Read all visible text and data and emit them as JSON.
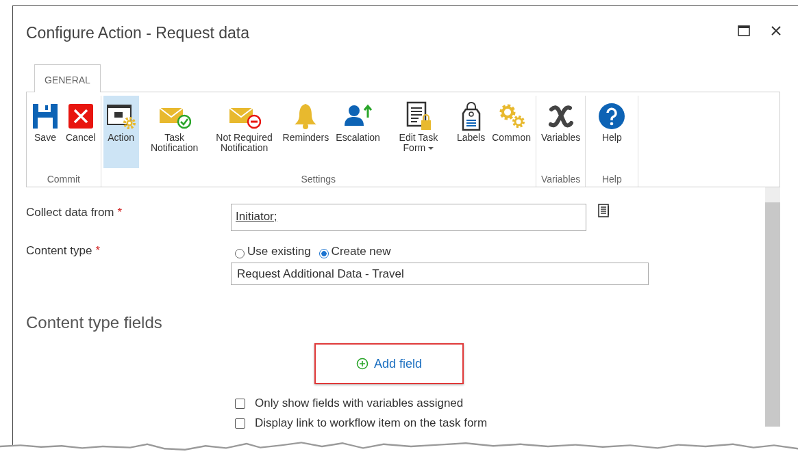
{
  "window": {
    "title": "Configure Action - Request data"
  },
  "tabs": [
    {
      "label": "GENERAL",
      "selected": true
    }
  ],
  "ribbon": {
    "groups": [
      {
        "label": "Commit",
        "buttons": [
          {
            "label": "Save",
            "selected": false
          },
          {
            "label": "Cancel",
            "selected": false
          }
        ]
      },
      {
        "label": "Settings",
        "buttons": [
          {
            "label": "Action",
            "selected": true
          },
          {
            "label": "Task Notification",
            "selected": false
          },
          {
            "label": "Not Required Notification",
            "selected": false
          },
          {
            "label": "Reminders",
            "selected": false
          },
          {
            "label": "Escalation",
            "selected": false
          },
          {
            "label": "Edit Task Form",
            "selected": false,
            "has_menu": true
          },
          {
            "label": "Labels",
            "selected": false
          },
          {
            "label": "Common",
            "selected": false
          }
        ]
      },
      {
        "label": "Variables",
        "buttons": [
          {
            "label": "Variables",
            "selected": false
          }
        ]
      },
      {
        "label": "Help",
        "buttons": [
          {
            "label": "Help",
            "selected": false
          }
        ]
      }
    ]
  },
  "form": {
    "collect": {
      "label": "Collect data from",
      "required_mark": "*",
      "value": "Initiator;"
    },
    "content_type": {
      "label": "Content type",
      "required_mark": "*",
      "options": [
        {
          "label": "Use existing",
          "selected": false
        },
        {
          "label": "Create new",
          "selected": true
        }
      ],
      "value": "Request Additional Data - Travel"
    },
    "section_title": "Content type fields",
    "add_field": "Add field",
    "checkboxes": [
      {
        "label": "Only show fields with variables assigned",
        "checked": false
      },
      {
        "label": "Display link to workflow item on the task form",
        "checked": false
      }
    ]
  }
}
